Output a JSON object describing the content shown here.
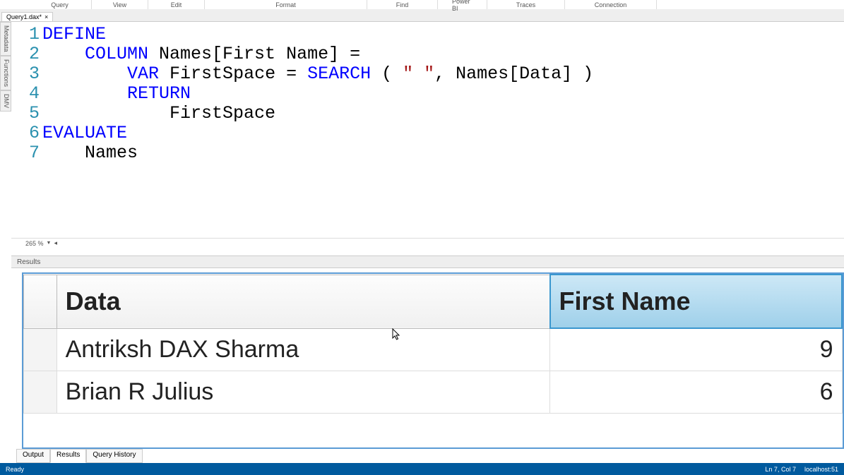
{
  "menu": [
    "Query",
    "View",
    "Edit",
    "Format",
    "Find",
    "Power BI",
    "Traces",
    "Connection"
  ],
  "tab": {
    "name": "Query1.dax*",
    "close": "×"
  },
  "side_tabs": [
    "Metadata",
    "Functions",
    "DMV"
  ],
  "code": {
    "lines": [
      {
        "n": 1,
        "segments": [
          {
            "t": "DEFINE",
            "c": "kw"
          }
        ]
      },
      {
        "n": 2,
        "segments": [
          {
            "t": "    ",
            "c": ""
          },
          {
            "t": "COLUMN",
            "c": "kw"
          },
          {
            "t": " Names[First Name] =",
            "c": ""
          }
        ]
      },
      {
        "n": 3,
        "segments": [
          {
            "t": "        ",
            "c": ""
          },
          {
            "t": "VAR",
            "c": "kw"
          },
          {
            "t": " FirstSpace = ",
            "c": ""
          },
          {
            "t": "SEARCH",
            "c": "fn"
          },
          {
            "t": " ( ",
            "c": ""
          },
          {
            "t": "\" \"",
            "c": "str"
          },
          {
            "t": ", Names[Data] )",
            "c": ""
          }
        ]
      },
      {
        "n": 4,
        "segments": [
          {
            "t": "        ",
            "c": ""
          },
          {
            "t": "RETURN",
            "c": "kw"
          }
        ]
      },
      {
        "n": 5,
        "segments": [
          {
            "t": "            FirstSpace",
            "c": ""
          }
        ]
      },
      {
        "n": 6,
        "segments": [
          {
            "t": "EVALUATE",
            "c": "kw"
          }
        ]
      },
      {
        "n": 7,
        "segments": [
          {
            "t": "    Names",
            "c": ""
          }
        ]
      }
    ]
  },
  "editor_footer": {
    "zoom": "265 %"
  },
  "results_label": "Results",
  "grid": {
    "columns": [
      {
        "label": "Data",
        "selected": false
      },
      {
        "label": "First Name",
        "selected": true
      }
    ],
    "rows": [
      {
        "data": "Antriksh DAX Sharma",
        "first_name": "9"
      },
      {
        "data": "Brian R Julius",
        "first_name": "6"
      }
    ]
  },
  "bottom_tabs": [
    {
      "label": "Output",
      "active": false
    },
    {
      "label": "Results",
      "active": true
    },
    {
      "label": "Query History",
      "active": false
    }
  ],
  "status": {
    "left": "Ready",
    "cursor": "Ln 7, Col 7",
    "conn": "localhost:51"
  }
}
